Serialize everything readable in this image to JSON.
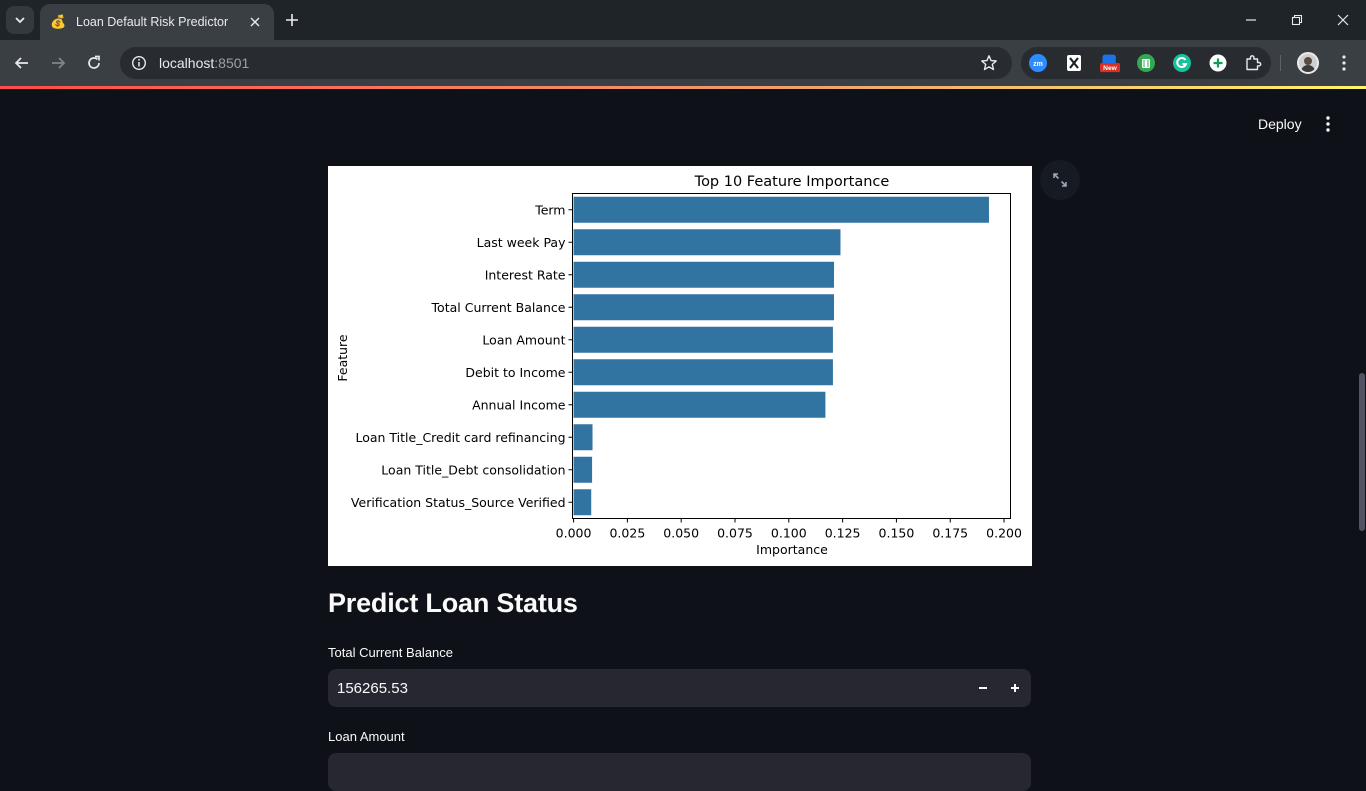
{
  "browser": {
    "tab_title": "Loan Default Risk Predictor",
    "url_host": "localhost",
    "url_port": ":8501",
    "extensions": [
      "zoom-icon",
      "puzzle-mask-icon",
      "new-badge-ext-icon",
      "android-ext-icon",
      "grammarly-icon",
      "plus-circle-icon",
      "extensions-icon"
    ],
    "new_badge": "New"
  },
  "streamlit": {
    "deploy_label": "Deploy"
  },
  "chart_data": {
    "type": "bar",
    "orientation": "horizontal",
    "title": "Top 10 Feature Importance",
    "xlabel": "Importance",
    "ylabel": "Feature",
    "categories": [
      "Term",
      "Last week Pay",
      "Interest Rate",
      "Total Current Balance",
      "Loan Amount",
      "Debit to Income",
      "Annual Income",
      "Loan Title_Credit card refinancing",
      "Loan Title_Debt consolidation",
      "Verification Status_Source Verified"
    ],
    "values": [
      0.193,
      0.124,
      0.121,
      0.121,
      0.1205,
      0.1205,
      0.117,
      0.0088,
      0.0086,
      0.0082
    ],
    "xlim": [
      -0.0005,
      0.203
    ],
    "xticks": [
      "0.000",
      "0.025",
      "0.050",
      "0.075",
      "0.100",
      "0.125",
      "0.150",
      "0.175",
      "0.200"
    ],
    "xtick_values": [
      0,
      0.025,
      0.05,
      0.075,
      0.1,
      0.125,
      0.15,
      0.175,
      0.2
    ],
    "bar_color": "#3274a1",
    "grid": false
  },
  "form": {
    "heading": "Predict Loan Status",
    "fields": [
      {
        "label": "Total Current Balance",
        "value": "156265.53"
      },
      {
        "label": "Loan Amount",
        "value": ""
      }
    ]
  }
}
